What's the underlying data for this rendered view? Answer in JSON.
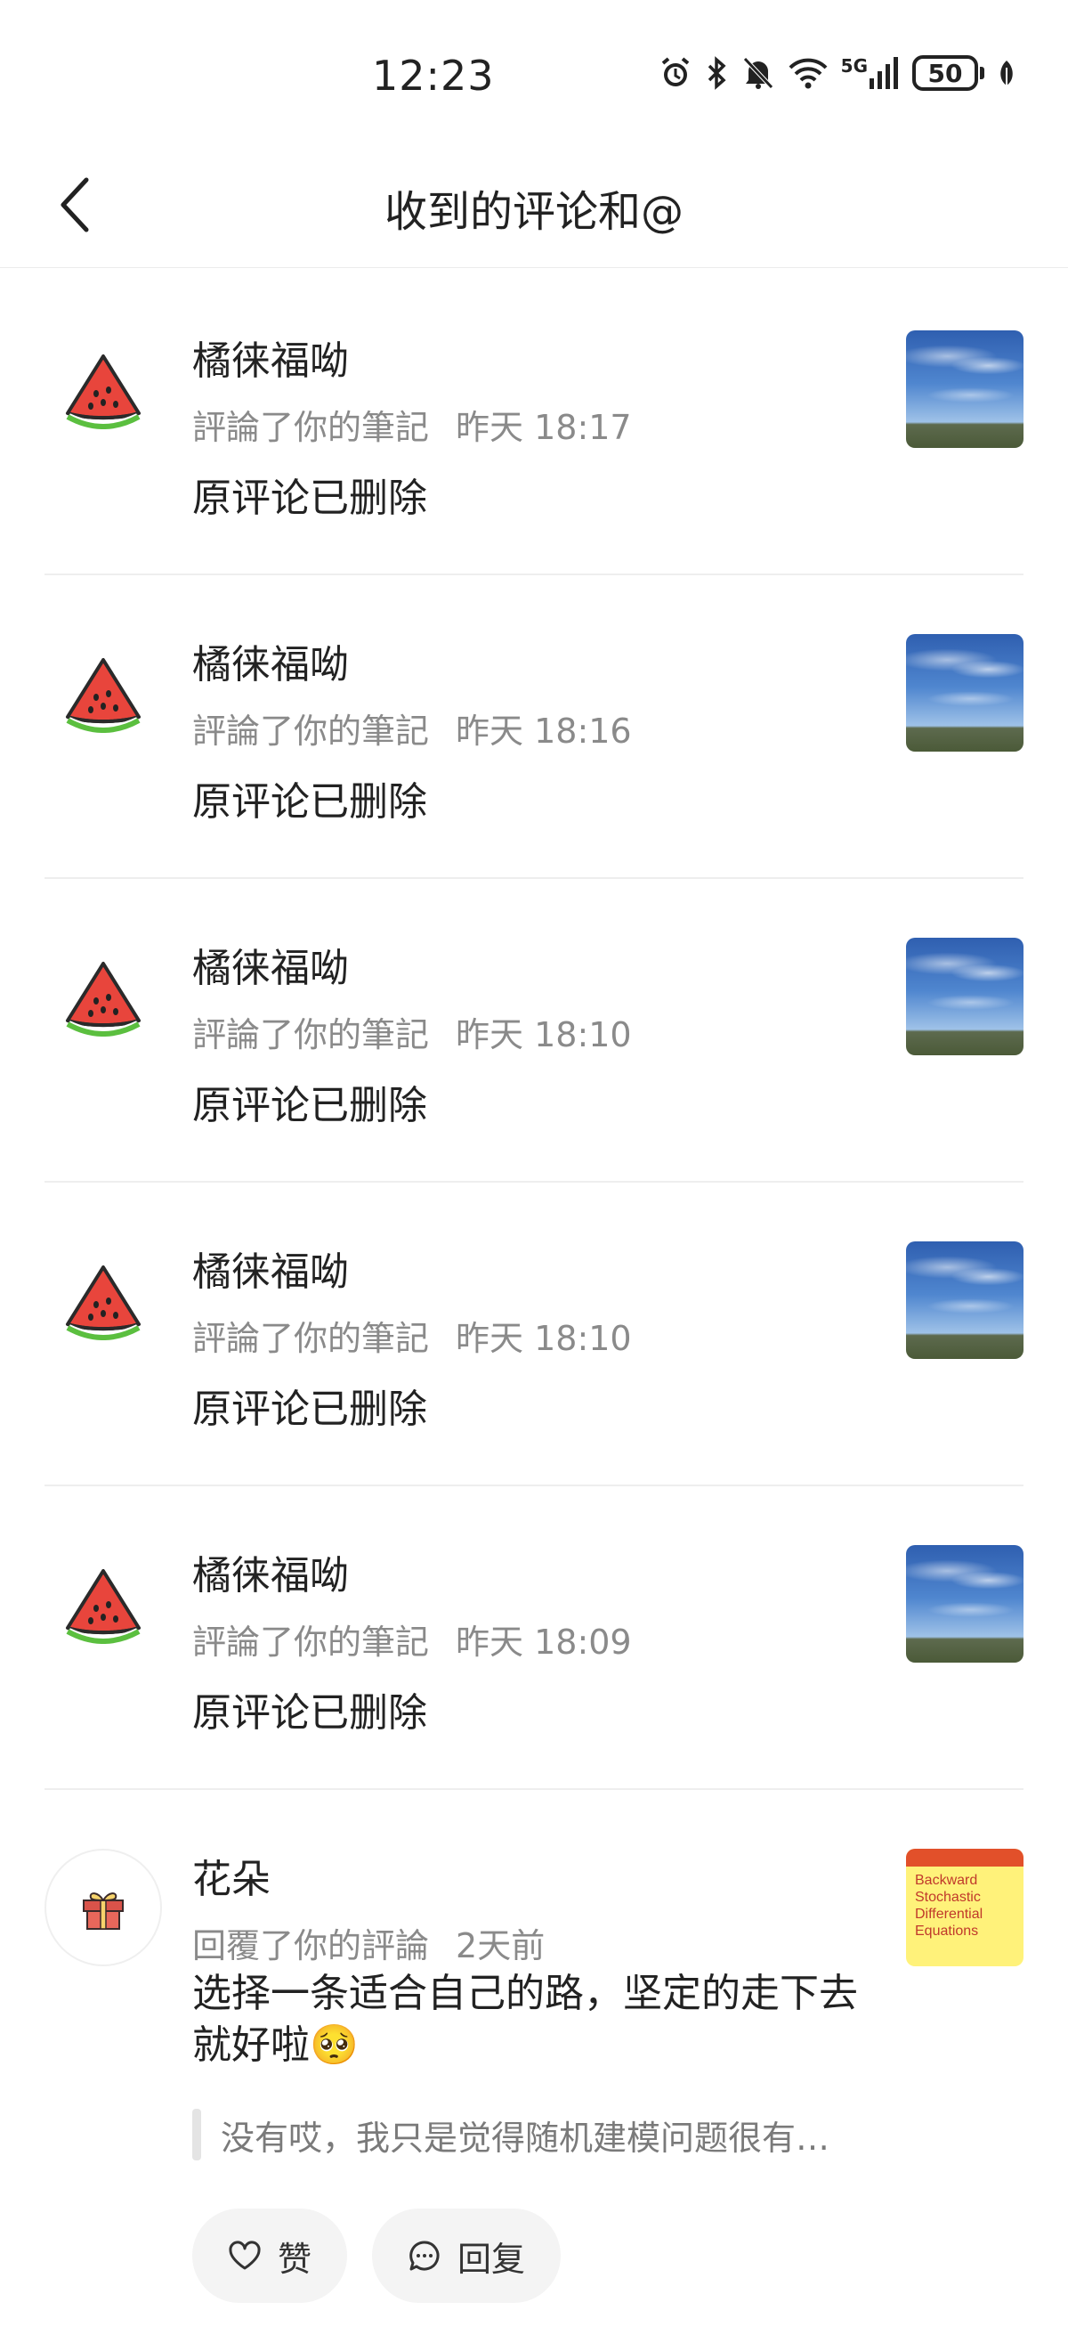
{
  "status_bar": {
    "time": "12:23",
    "network": "5G",
    "battery": "50",
    "icons": [
      "alarm-icon",
      "bluetooth-icon",
      "mute-icon",
      "wifi-icon",
      "signal-icon",
      "battery-icon",
      "leaf-icon"
    ]
  },
  "header": {
    "title": "收到的评论和@",
    "back_icon": "chevron-left-icon"
  },
  "notifications": [
    {
      "user": "橘徕福呦",
      "action": "評論了你的筆記",
      "time": "昨天 18:17",
      "content": "原评论已删除",
      "avatar": "watermelon-icon",
      "thumbnail": "sky-photo"
    },
    {
      "user": "橘徕福呦",
      "action": "評論了你的筆記",
      "time": "昨天 18:16",
      "content": "原评论已删除",
      "avatar": "watermelon-icon",
      "thumbnail": "sky-photo"
    },
    {
      "user": "橘徕福呦",
      "action": "評論了你的筆記",
      "time": "昨天 18:10",
      "content": "原评论已删除",
      "avatar": "watermelon-icon",
      "thumbnail": "sky-photo"
    },
    {
      "user": "橘徕福呦",
      "action": "評論了你的筆記",
      "time": "昨天 18:10",
      "content": "原评论已删除",
      "avatar": "watermelon-icon",
      "thumbnail": "sky-photo"
    },
    {
      "user": "橘徕福呦",
      "action": "評論了你的筆記",
      "time": "昨天 18:09",
      "content": "原评论已删除",
      "avatar": "watermelon-icon",
      "thumbnail": "sky-photo"
    },
    {
      "user": "花朵",
      "action": "回覆了你的評論",
      "time": "2天前",
      "content": "选择一条适合自己的路，坚定的走下去就好啦",
      "emoji": "🥺",
      "quote": "没有哎，我只是觉得随机建模问题很有…",
      "avatar": "gift-icon",
      "thumbnail": "book-cover",
      "book_title": "Backward Stochastic Differential Equations",
      "like_label": "赞",
      "reply_label": "回复"
    }
  ]
}
